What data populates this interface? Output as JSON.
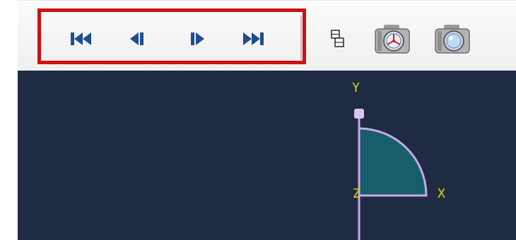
{
  "toolbar": {
    "buttons": [
      {
        "name": "first-frame-button",
        "icon": "skip-to-first-icon"
      },
      {
        "name": "previous-frame-button",
        "icon": "step-back-icon"
      },
      {
        "name": "next-frame-button",
        "icon": "step-forward-icon"
      },
      {
        "name": "last-frame-button",
        "icon": "skip-to-last-icon"
      },
      {
        "name": "overlay-button",
        "icon": "overlay-layers-icon"
      },
      {
        "name": "camera-settings-button",
        "icon": "camera-settings-icon"
      },
      {
        "name": "camera-button",
        "icon": "camera-icon"
      }
    ],
    "icon_color": "#1f4e8c",
    "highlight_color": "#cc1111"
  },
  "viewport": {
    "background": "#1e2b43",
    "axis_color": "#c9a6e8",
    "fill_color": "#165e6b",
    "label_color": "#e8d400",
    "axes": {
      "y": "Y",
      "x": "X",
      "z": "Z"
    }
  }
}
